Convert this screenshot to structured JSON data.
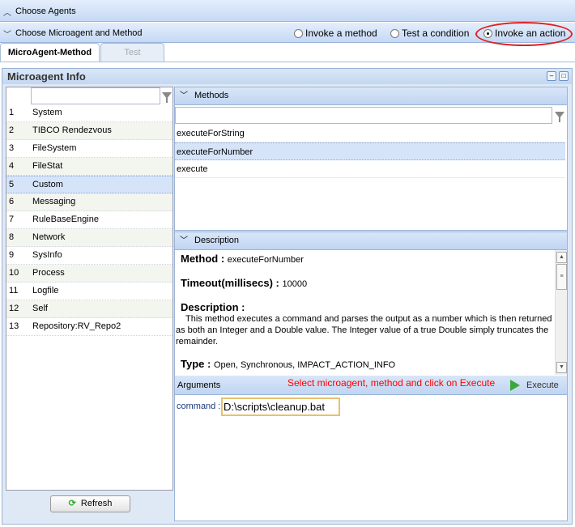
{
  "sections": {
    "choose_agents": "Choose Agents",
    "choose_microagent": "Choose Microagent and Method"
  },
  "modes": [
    {
      "label": "Invoke a method",
      "selected": false
    },
    {
      "label": "Test a condition",
      "selected": false
    },
    {
      "label": "Invoke an action",
      "selected": true
    }
  ],
  "tabs": [
    "MicroAgent-Method",
    "Test"
  ],
  "panel": {
    "title": "Microagent Info",
    "minimize": "–",
    "maximize": "□"
  },
  "agents": [
    {
      "n": "1",
      "name": "System"
    },
    {
      "n": "2",
      "name": "TIBCO Rendezvous"
    },
    {
      "n": "3",
      "name": "FileSystem"
    },
    {
      "n": "4",
      "name": "FileStat"
    },
    {
      "n": "5",
      "name": "Custom"
    },
    {
      "n": "6",
      "name": "Messaging"
    },
    {
      "n": "7",
      "name": "RuleBaseEngine"
    },
    {
      "n": "8",
      "name": "Network"
    },
    {
      "n": "9",
      "name": "SysInfo"
    },
    {
      "n": "10",
      "name": "Process"
    },
    {
      "n": "11",
      "name": "Logfile"
    },
    {
      "n": "12",
      "name": "Self"
    },
    {
      "n": "13",
      "name": "Repository:RV_Repo2"
    }
  ],
  "refresh_label": "Refresh",
  "methods": {
    "title": "Methods",
    "items": [
      "executeForString",
      "executeForNumber",
      "execute"
    ]
  },
  "description": {
    "title": "Description",
    "method_label": "Method :",
    "method": "executeForNumber",
    "timeout_label": "Timeout(millisecs) :",
    "timeout": "10000",
    "desc_label": "Description :",
    "desc": "This method executes a command and parses the output as a number which is then returned as both an Integer and a Double value. The Integer value of a true Double simply truncates the remainder.",
    "type_label": "Type :",
    "type": "Open, Synchronous, IMPACT_ACTION_INFO"
  },
  "arguments": {
    "title": "Arguments",
    "hint": "Select microagent, method and click on Execute",
    "execute": "Execute",
    "command_label": "command :",
    "command_value": "D:\\scripts\\cleanup.bat"
  },
  "colors": {
    "hint": "#ff0000",
    "highlight_circle": "#e02020"
  }
}
